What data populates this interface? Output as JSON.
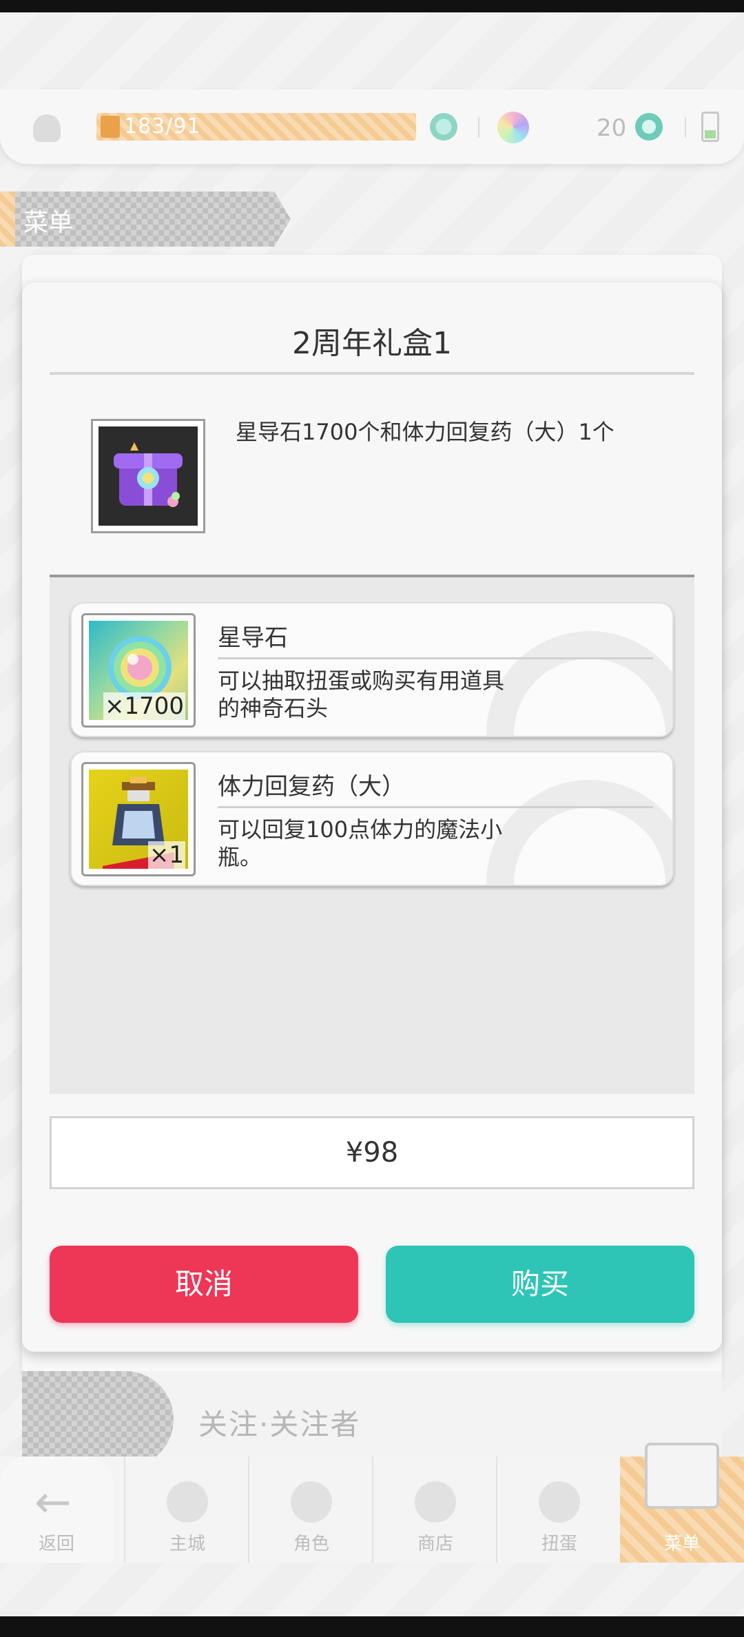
{
  "topbar": {
    "stamina": "183/91",
    "gems_count": "20"
  },
  "menu_tag": {
    "label": "菜单"
  },
  "background": {
    "follow_label": "关注·关注者"
  },
  "nav": {
    "back": "返回",
    "items": [
      {
        "label": "主城",
        "icon": "castle-icon"
      },
      {
        "label": "角色",
        "icon": "character-icon"
      },
      {
        "label": "商店",
        "icon": "shop-icon"
      },
      {
        "label": "扭蛋",
        "icon": "gacha-icon"
      },
      {
        "label": "菜单",
        "icon": "menu-box-icon"
      }
    ]
  },
  "modal": {
    "title": "2周年礼盒1",
    "pack_description": "星导石1700个和体力回复药（大）1个",
    "items": [
      {
        "name": "星导石",
        "description": "可以抽取扭蛋或购买有用道具的神奇石头",
        "qty": "×1700"
      },
      {
        "name": "体力回复药（大）",
        "description": "可以回复100点体力的魔法小瓶。",
        "qty": "×1"
      }
    ],
    "price": "¥98",
    "cancel_label": "取消",
    "buy_label": "购买"
  },
  "colors": {
    "cancel": "#ee3657",
    "buy": "#2ec5b6",
    "stamina_bar": "#f5cb93"
  }
}
